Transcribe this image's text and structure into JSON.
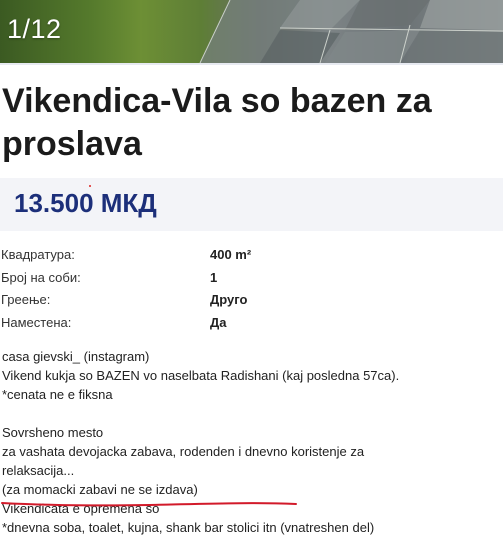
{
  "gallery": {
    "counter": "1/12"
  },
  "listing": {
    "title": "Vikendica-Vila so bazen za proslava",
    "price": "13.500 МКД"
  },
  "specs": [
    {
      "label": "Квадратура:",
      "value": "400 m²"
    },
    {
      "label": "Број на соби:",
      "value": "1"
    },
    {
      "label": "Греење:",
      "value": "Друго"
    },
    {
      "label": "Наместена:",
      "value": "Да"
    }
  ],
  "description": [
    "casa gievski_ (instagram)",
    "Vikend kukja so BAZEN vo naselbata Radishani (kaj poslednа 57ca).",
    "*cenata ne e fiksna",
    "",
    "Sovrsheno mesto",
    "za vashata devojacka zabava, rodenden i dnevno koristenje za",
    "relaksacija...",
    "(za momacki zabavi ne se izdava)",
    "Vikendicata e opremena so",
    "*dnevna soba, toalet, kujna, shank bar stolici itn (vnatreshen del)"
  ],
  "colors": {
    "price": "#1c2f7a",
    "price_bg": "#f3f4f8",
    "annotation_underline": "#d21a2a"
  }
}
